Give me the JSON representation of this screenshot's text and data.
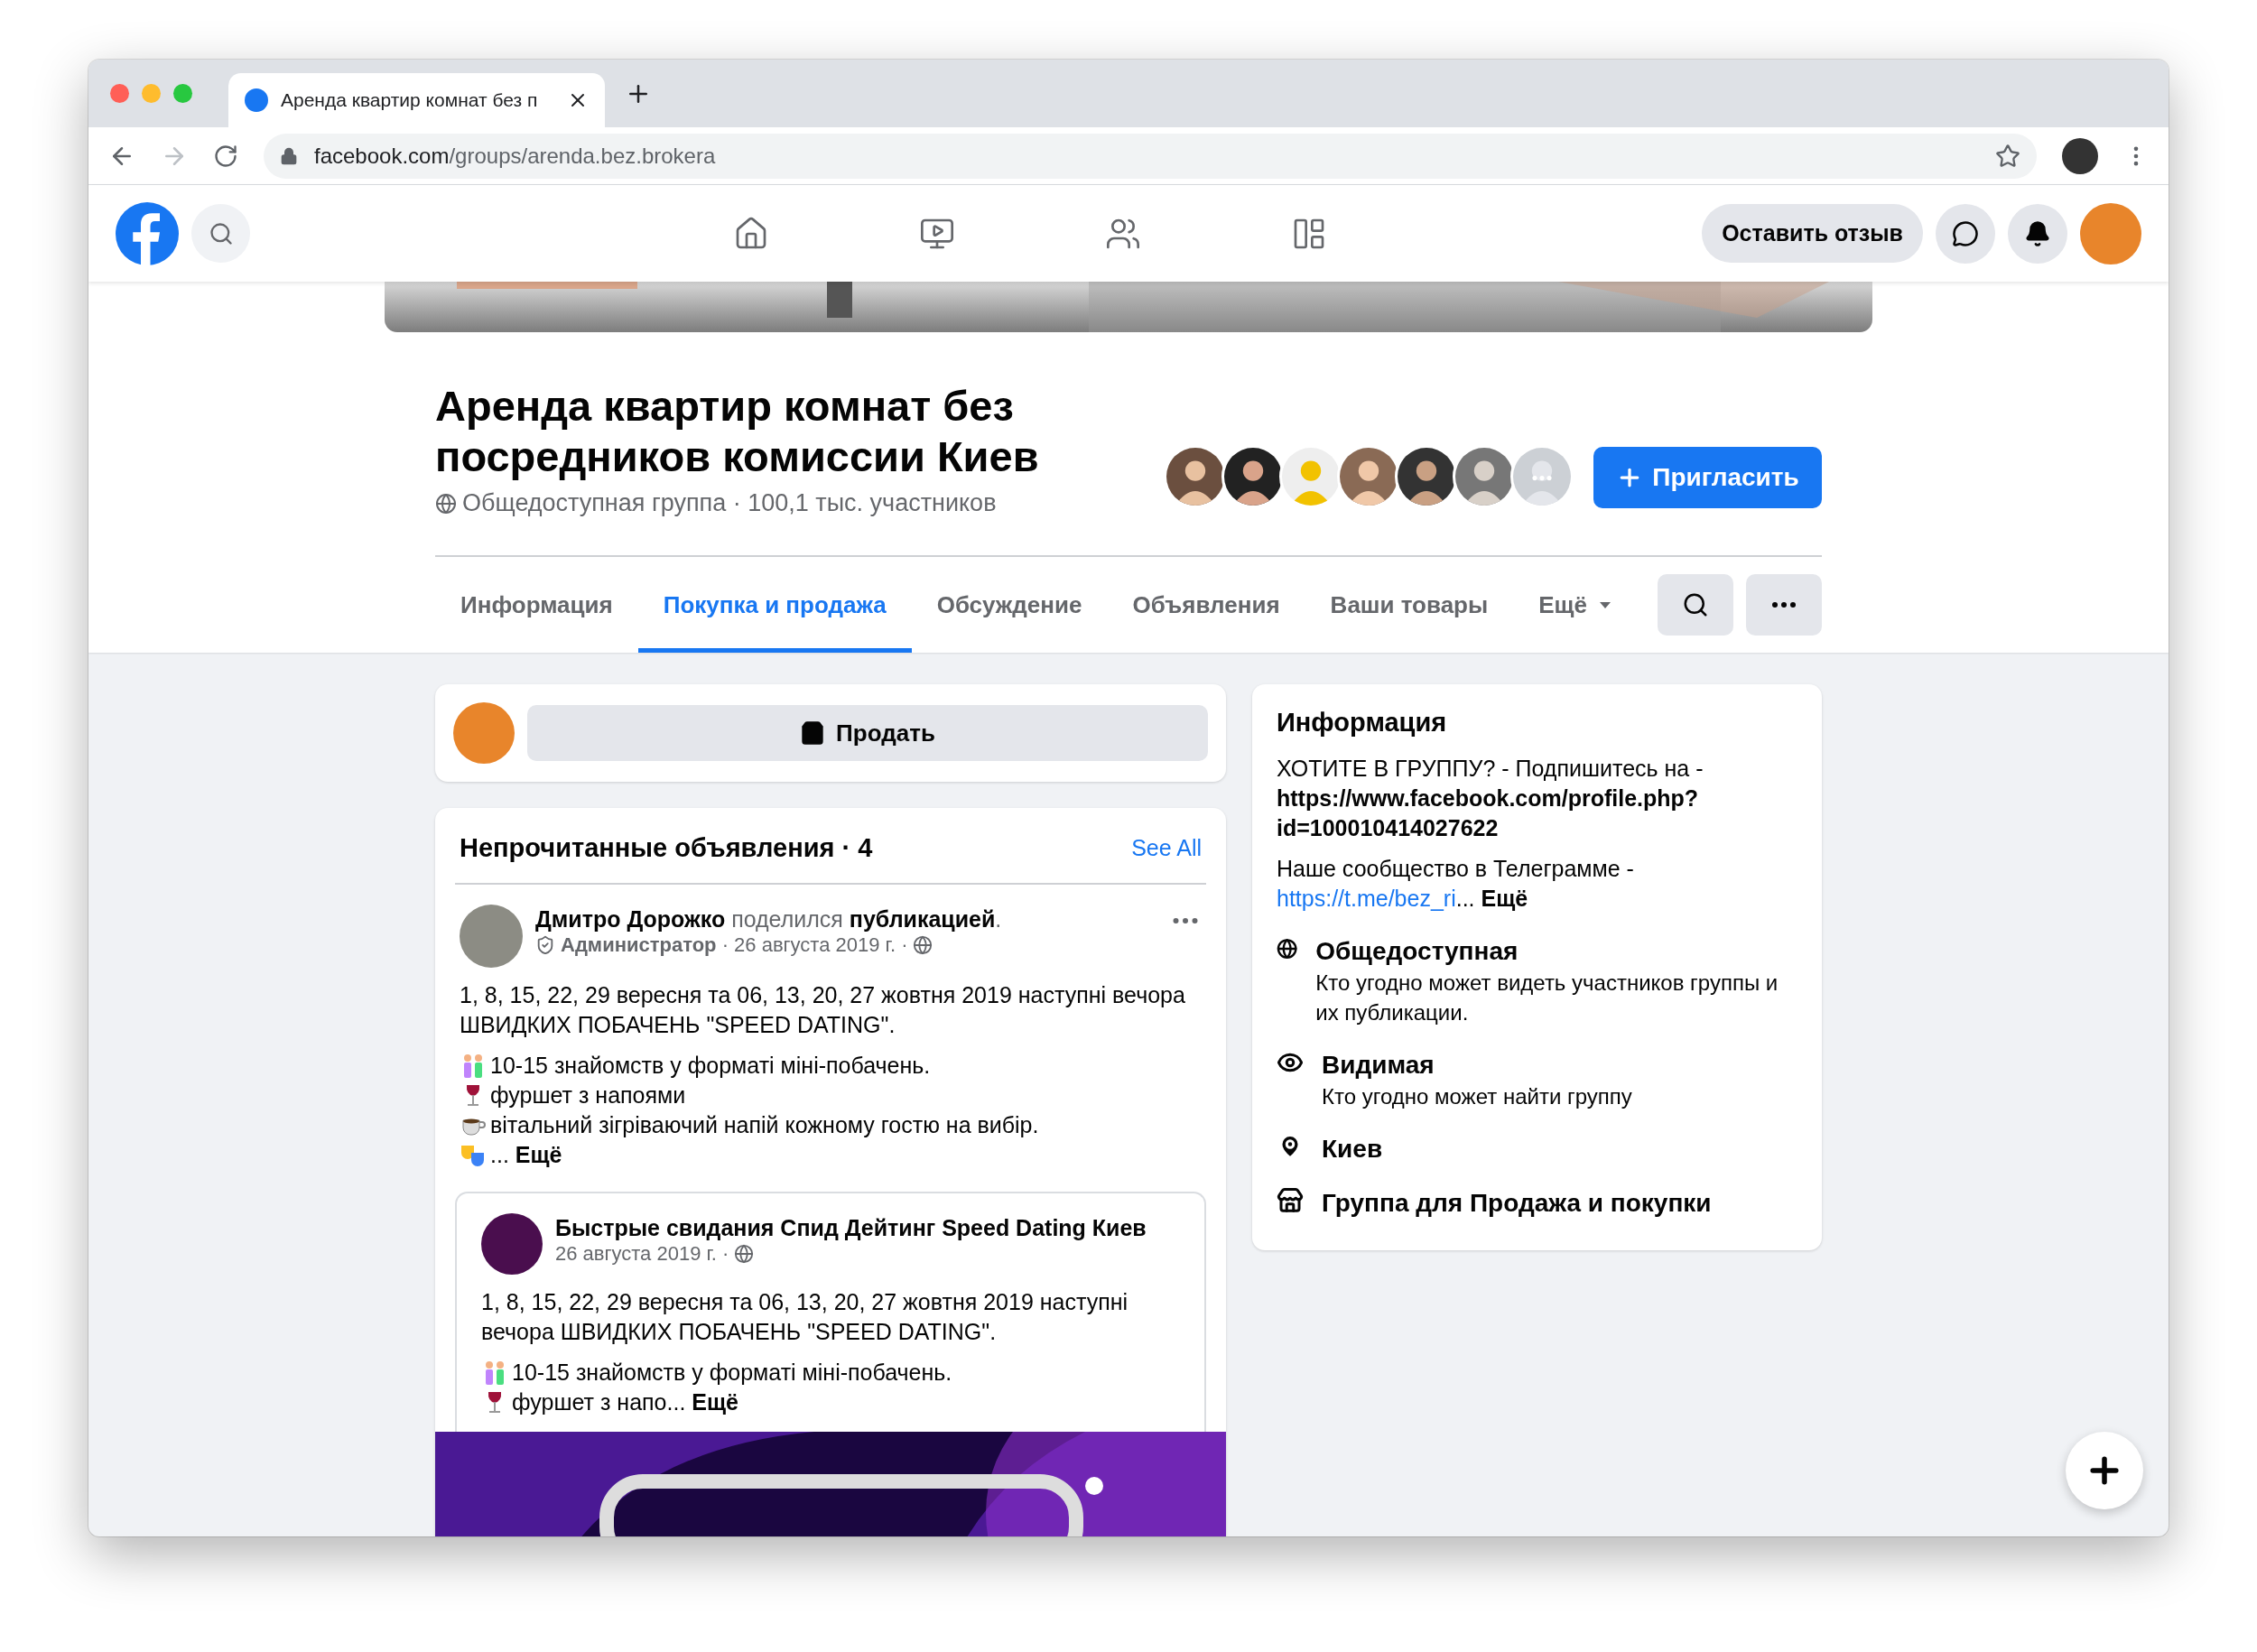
{
  "browser": {
    "tab_title": "Аренда квартир комнат без п",
    "url_host": "facebook.com",
    "url_path": "/groups/arenda.bez.brokera"
  },
  "top_nav": {
    "feedback_button": "Оставить отзыв"
  },
  "group": {
    "title": "Аренда квартир комнат без посредников комиссии Киев",
    "meta": "Общедоступная группа · 100,1 тыс. участников",
    "invite_button": "Пригласить"
  },
  "tabs": [
    {
      "label": "Информация",
      "selected": false
    },
    {
      "label": "Покупка и продажа",
      "selected": true
    },
    {
      "label": "Обсуждение",
      "selected": false
    },
    {
      "label": "Объявления",
      "selected": false
    },
    {
      "label": "Ваши товары",
      "selected": false
    }
  ],
  "more_tab": "Ещё",
  "sell_button": "Продать",
  "unread": {
    "title": "Непрочитанные объявления · 4",
    "see_all": "See All",
    "post": {
      "header": "**Дмитро Дорожко** поделился **публикацией**.",
      "meta": "**Администратор** · 26 августа 2019 г. ·",
      "paragraph": "1, 8, 15, 22, 29 вересня та 06, 13, 20, 27 жовтня 2019 наступні вечора ШВИДКИХ ПОБАЧЕНЬ \"SPEED DATING\".",
      "lines": [
        {
          "kind": "couple",
          "text": "10-15 знайомств у форматі міні-побачень."
        },
        {
          "kind": "wine",
          "text": "фуршет з напоями"
        },
        {
          "kind": "cup",
          "text": "вітальний зігріваючий напій кожному гостю на вибір."
        },
        {
          "kind": "masks",
          "text": "... **Ещё**"
        }
      ],
      "shared": {
        "page": "Быстрые свидания Спид Дейтинг Speed Dating Киев",
        "date": "26 августа 2019 г. ·",
        "paragraph": "1, 8, 15, 22, 29 вересня та 06, 13, 20, 27 жовтня 2019 наступні вечора ШВИДКИХ ПОБАЧЕНЬ \"SPEED DATING\".",
        "lines": [
          {
            "kind": "couple",
            "text": "10-15 знайомств у форматі міні-побачень."
          },
          {
            "kind": "wine",
            "text": "фуршет з напо... **Ещё**"
          }
        ]
      }
    }
  },
  "info": {
    "title": "Информация",
    "about": "ХОТИТЕ В ГРУППУ? - Подпишитесь на - **https://www.facebook.com/profile.php?id=100010414027622**",
    "telegram": {
      "text": "Наше сообщество в Телеграмме -",
      "link": "https://t.me/bez_ri",
      "tail": "... **Ещё**"
    },
    "items": [
      {
        "kind": "globe",
        "title": "Общедоступная",
        "text": "Кто угодно может видеть участников группы и их публикации."
      },
      {
        "kind": "eye",
        "title": "Видимая",
        "text": "Кто угодно может найти группу"
      },
      {
        "kind": "pin",
        "title": "Киев"
      },
      {
        "kind": "shop",
        "title": "Группа для Продажа и покупки"
      }
    ]
  }
}
